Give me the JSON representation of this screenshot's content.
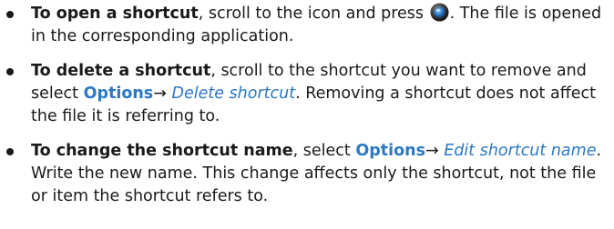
{
  "bullets": [
    {
      "lead": "To open a shortcut",
      "part1": ", scroll to the icon and press ",
      "icon": "select-key-icon",
      "part2": ". The file is opened in the corresponding application."
    },
    {
      "lead": "To delete a shortcut",
      "part1": ", scroll to the shortcut you want to remove and select ",
      "menu": "Options",
      "arrow": "→",
      "command": "Delete shortcut",
      "part2": ". Removing a shortcut does not affect the file it is referring to."
    },
    {
      "lead": "To change the shortcut name",
      "part1": ", select ",
      "menu": "Options",
      "arrow": "→",
      "command": "Edit shortcut name",
      "part2": ". Write the new name. This change affects only the shortcut, not the file or item the shortcut refers to."
    }
  ],
  "colors": {
    "text": "#1a1a1a",
    "link": "#2b78c5"
  }
}
